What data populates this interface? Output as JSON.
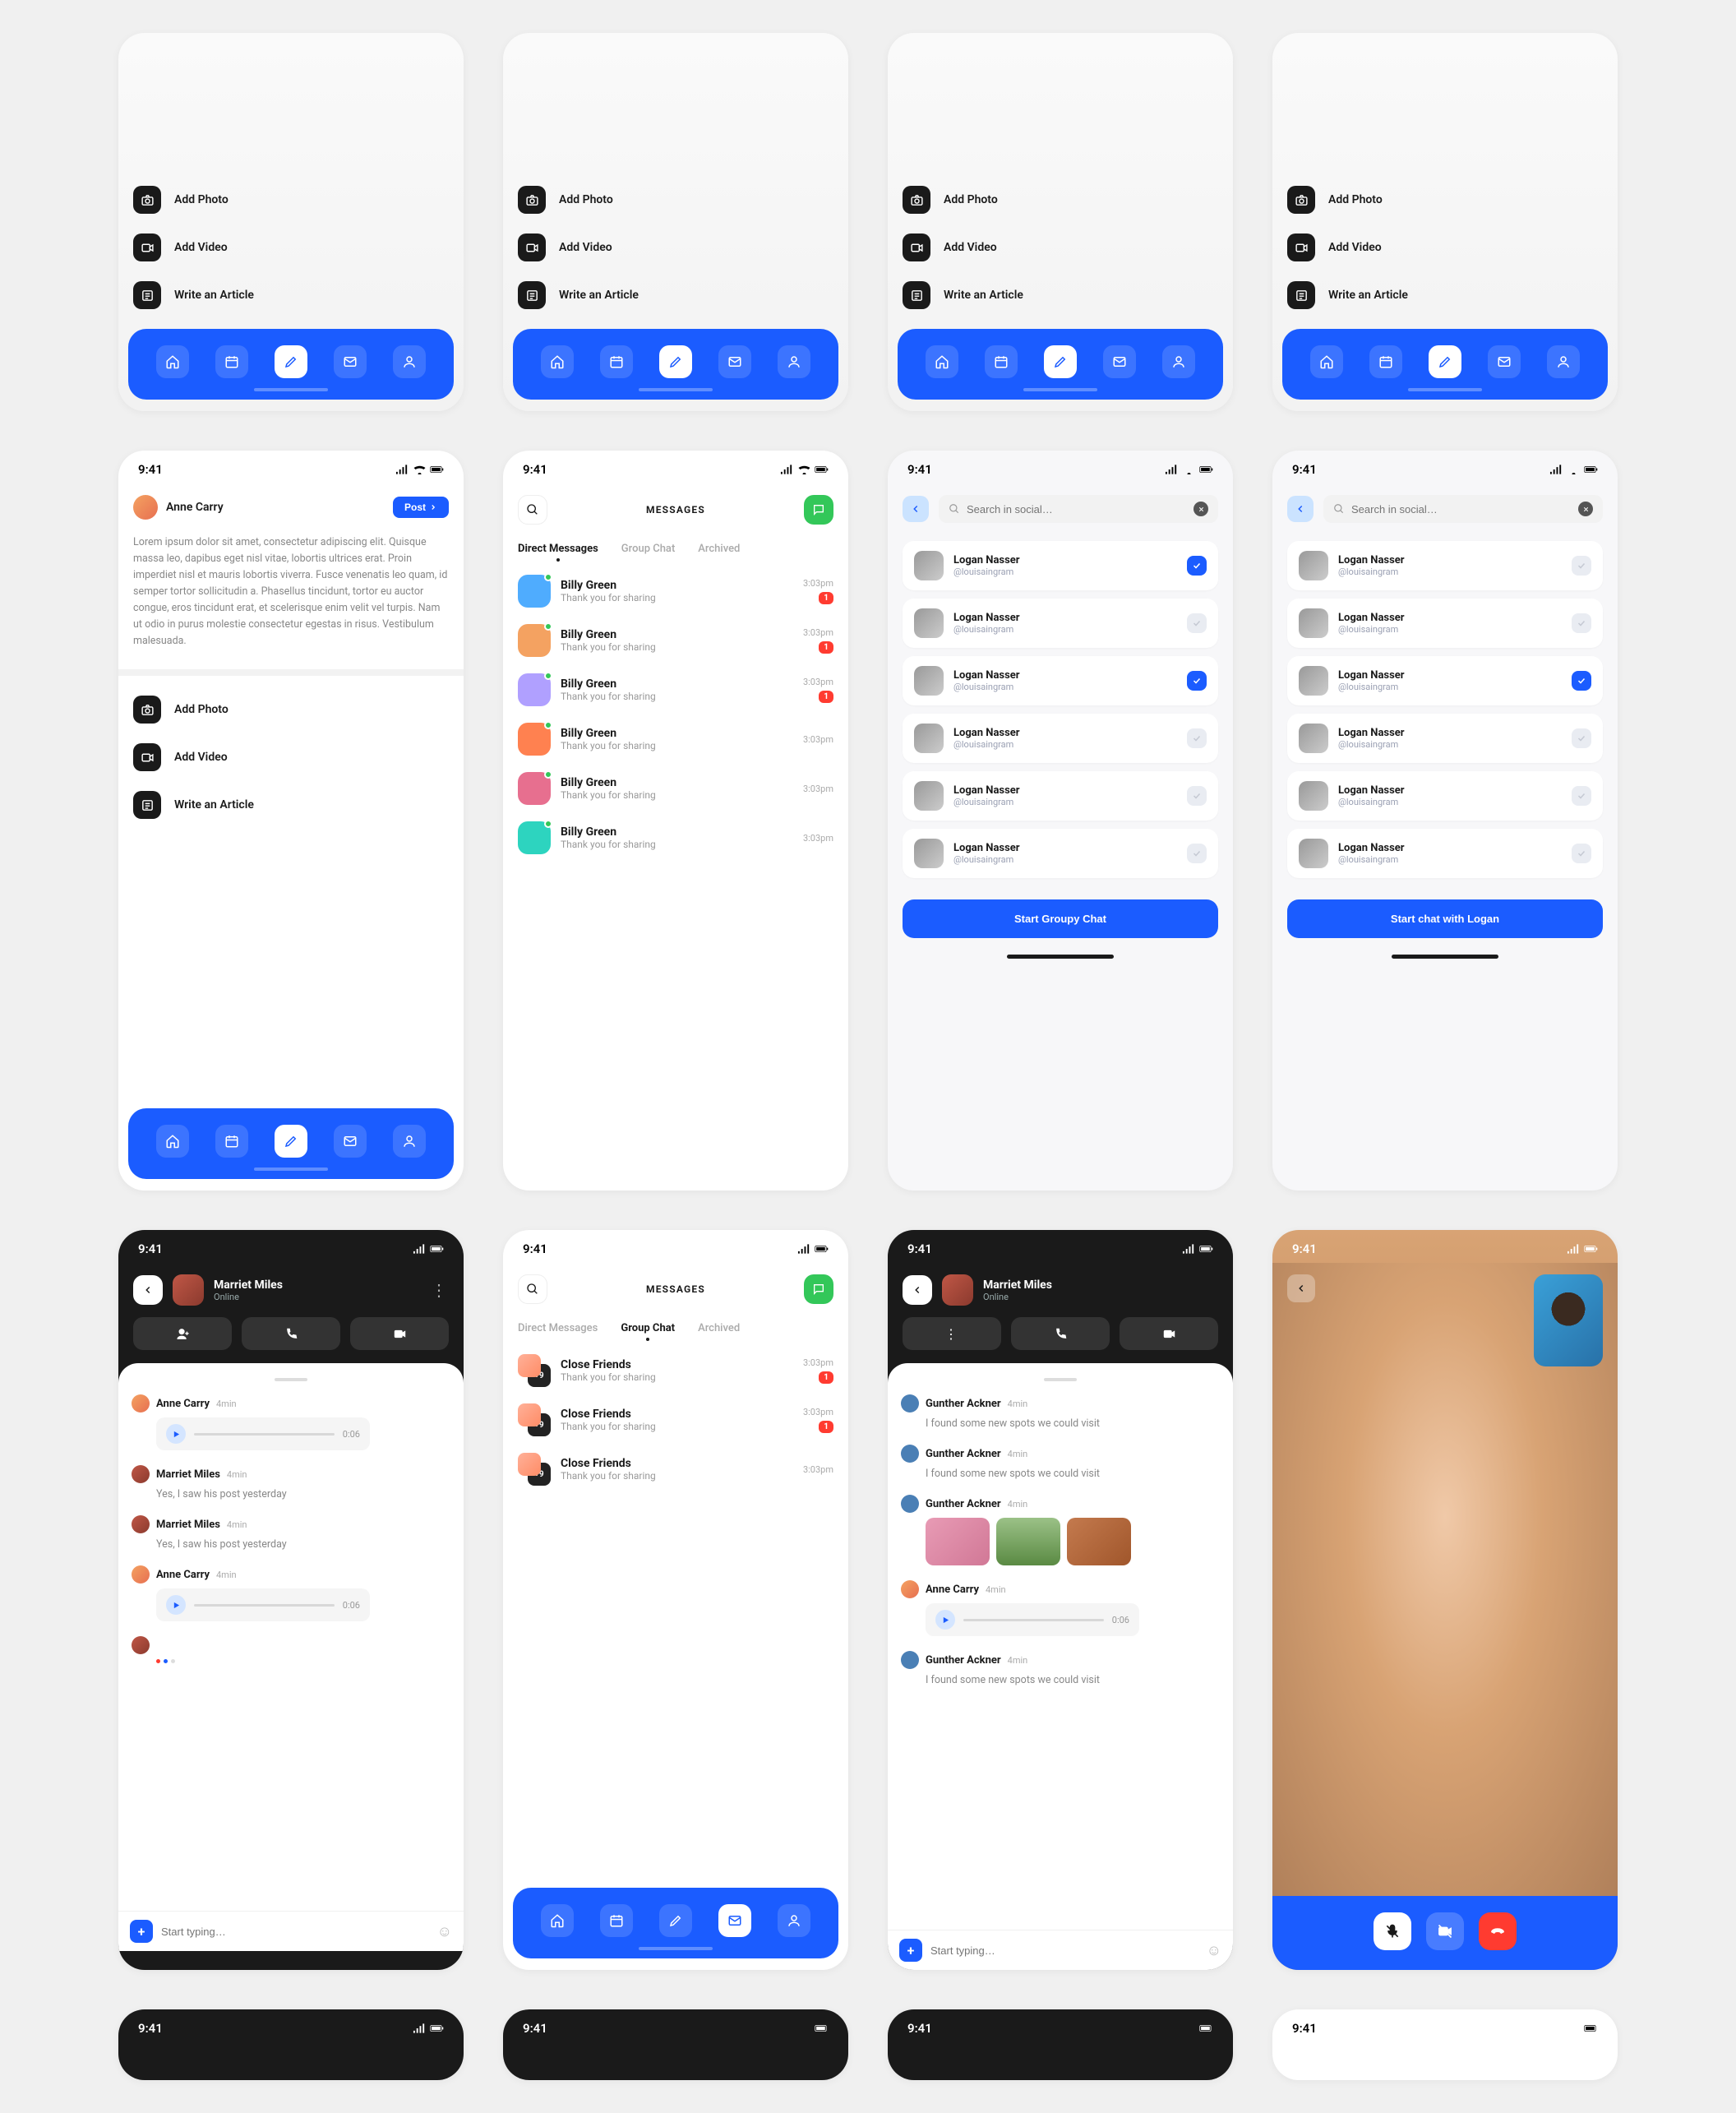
{
  "status_time": "9:41",
  "actions": {
    "add_photo": "Add Photo",
    "add_video": "Add Video",
    "write_article": "Write an Article"
  },
  "post": {
    "user": "Anne Carry",
    "btn_label": "Post",
    "body": "Lorem ipsum dolor sit amet, consectetur adipiscing elit. Quisque massa leo, dapibus eget nisl vitae, lobortis ultrices erat. Proin imperdiet nisl et mauris lobortis viverra. Fusce venenatis leo quam, id semper tortor sollicitudin a. Phasellus tincidunt, tortor eu auctor congue, eros tincidunt erat, et scelerisque enim velit vel turpis. Nam ut odio in purus molestie consectetur egestas in risus. Vestibulum malesuada."
  },
  "messages": {
    "title": "MESSAGES",
    "tabs": {
      "direct": "Direct Messages",
      "group": "Group Chat",
      "archived": "Archived"
    },
    "dm_items": [
      {
        "name": "Billy Green",
        "sub": "Thank you for sharing",
        "time": "3:03pm",
        "badge": "1"
      },
      {
        "name": "Billy Green",
        "sub": "Thank you for sharing",
        "time": "3:03pm",
        "badge": "1"
      },
      {
        "name": "Billy Green",
        "sub": "Thank you for sharing",
        "time": "3:03pm",
        "badge": "1"
      },
      {
        "name": "Billy Green",
        "sub": "Thank you for sharing",
        "time": "3:03pm"
      },
      {
        "name": "Billy Green",
        "sub": "Thank you for sharing",
        "time": "3:03pm"
      },
      {
        "name": "Billy Green",
        "sub": "Thank you for sharing",
        "time": "3:03pm"
      }
    ],
    "group_items": [
      {
        "name": "Close Friends",
        "sub": "Thank you for sharing",
        "time": "3:03pm",
        "badge": "1",
        "extra": "+9"
      },
      {
        "name": "Close Friends",
        "sub": "Thank you for sharing",
        "time": "3:03pm",
        "badge": "1",
        "extra": "+9"
      },
      {
        "name": "Close Friends",
        "sub": "Thank you for sharing",
        "time": "3:03pm",
        "extra": "+9"
      }
    ]
  },
  "search": {
    "placeholder": "Search in social…",
    "contact_name": "Logan Nasser",
    "contact_handle": "@louisaingram",
    "btn_group": "Start Groupy Chat",
    "btn_single": "Start chat with Logan"
  },
  "chat": {
    "user_name": "Marriet Miles",
    "status": "Online",
    "anne": "Anne Carry",
    "marriet": "Marriet Miles",
    "gunther": "Gunther Ackner",
    "time_4min": "4min",
    "line_post": "Yes, I saw his post yesterday",
    "line_spot": "I found some new spots we could visit",
    "voice_dur": "0:06",
    "input_ph": "Start typing…"
  }
}
